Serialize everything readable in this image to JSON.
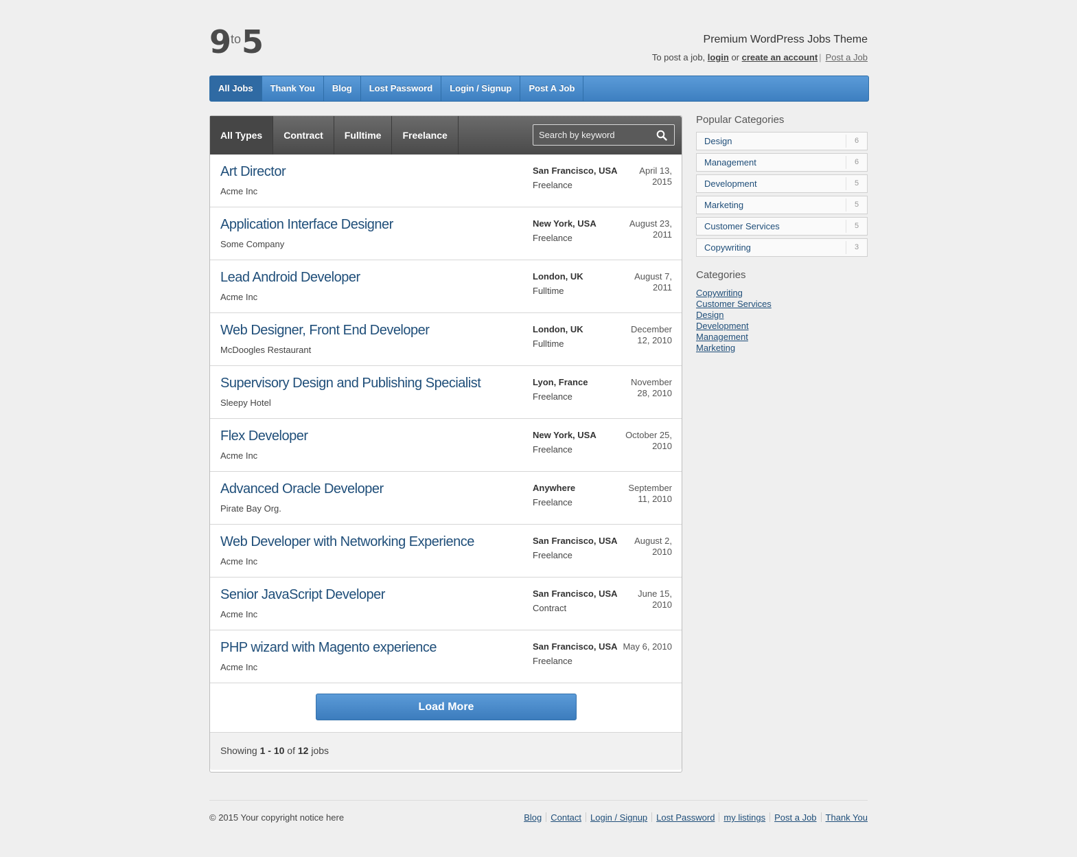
{
  "header": {
    "logo": {
      "left": "9",
      "middle": "to",
      "right": "5"
    },
    "tagline": "Premium WordPress Jobs Theme",
    "post_prefix": "To post a job, ",
    "login_label": "login",
    "or_text": " or ",
    "create_label": "create an account",
    "sep": "|",
    "post_job_label": "Post a Job"
  },
  "nav": {
    "items": [
      {
        "label": "All Jobs",
        "active": true
      },
      {
        "label": "Thank You"
      },
      {
        "label": "Blog"
      },
      {
        "label": "Lost Password"
      },
      {
        "label": "Login / Signup"
      },
      {
        "label": "Post A Job"
      }
    ]
  },
  "filters": {
    "types": [
      "All Types",
      "Contract",
      "Fulltime",
      "Freelance"
    ],
    "search_placeholder": "Search by keyword"
  },
  "jobs": [
    {
      "title": "Art Director",
      "company": "Acme Inc",
      "location": "San Francisco, USA",
      "type": "Freelance",
      "date": "April 13, 2015"
    },
    {
      "title": "Application Interface Designer",
      "company": "Some Company",
      "location": "New York, USA",
      "type": "Freelance",
      "date": "August 23, 2011"
    },
    {
      "title": "Lead Android Developer",
      "company": "Acme Inc",
      "location": "London, UK",
      "type": "Fulltime",
      "date": "August 7, 2011"
    },
    {
      "title": "Web Designer, Front End Developer",
      "company": "McDoogles Restaurant",
      "location": "London, UK",
      "type": "Fulltime",
      "date": "December 12, 2010"
    },
    {
      "title": "Supervisory Design and Publishing Specialist",
      "company": "Sleepy Hotel",
      "location": "Lyon, France",
      "type": "Freelance",
      "date": "November 28, 2010"
    },
    {
      "title": "Flex Developer",
      "company": "Acme Inc",
      "location": "New York, USA",
      "type": "Freelance",
      "date": "October 25, 2010"
    },
    {
      "title": "Advanced Oracle Developer",
      "company": "Pirate Bay Org.",
      "location": "Anywhere",
      "type": "Freelance",
      "date": "September 11, 2010"
    },
    {
      "title": "Web Developer with Networking Experience",
      "company": "Acme Inc",
      "location": "San Francisco, USA",
      "type": "Freelance",
      "date": "August 2, 2010"
    },
    {
      "title": "Senior JavaScript Developer",
      "company": "Acme Inc",
      "location": "San Francisco, USA",
      "type": "Contract",
      "date": "June 15, 2010"
    },
    {
      "title": "PHP wizard with Magento experience",
      "company": "Acme Inc",
      "location": "San Francisco, USA",
      "type": "Freelance",
      "date": "May 6, 2010"
    }
  ],
  "load_more_label": "Load More",
  "showing": {
    "prefix": "Showing ",
    "range": "1 - 10",
    "of": " of ",
    "total": "12",
    "suffix": " jobs"
  },
  "sidebar": {
    "popular_title": "Popular Categories",
    "popular": [
      {
        "label": "Design",
        "count": "6"
      },
      {
        "label": "Management",
        "count": "6"
      },
      {
        "label": "Development",
        "count": "5"
      },
      {
        "label": "Marketing",
        "count": "5"
      },
      {
        "label": "Customer Services",
        "count": "5"
      },
      {
        "label": "Copywriting",
        "count": "3"
      }
    ],
    "categories_title": "Categories",
    "categories": [
      "Copywriting",
      "Customer Services",
      "Design",
      "Development",
      "Management",
      "Marketing"
    ]
  },
  "footer": {
    "copyright": "© 2015 Your copyright notice here",
    "links": [
      "Blog",
      "Contact",
      "Login / Signup",
      "Lost Password",
      "my listings",
      "Post a Job",
      "Thank You"
    ]
  },
  "colors": {
    "accent": "#4a8bcc",
    "link": "#1f4e79",
    "filterbar": "#555555"
  }
}
